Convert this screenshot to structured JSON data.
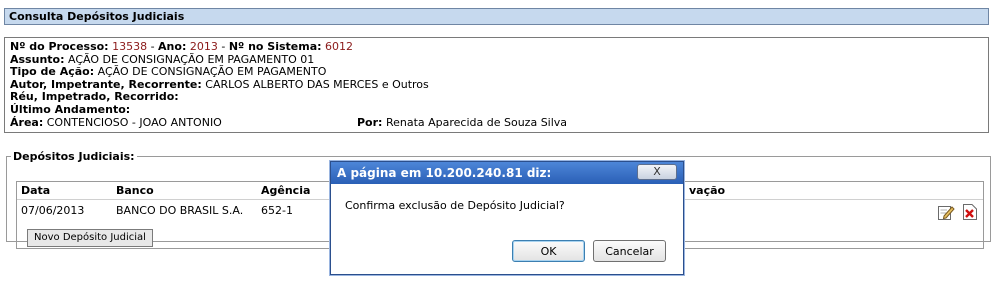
{
  "page": {
    "title": "Consulta Depósitos Judiciais"
  },
  "processo": {
    "numero_label": "Nº do Processo:",
    "numero": "13538",
    "ano_label": "Ano:",
    "ano": "2013",
    "sistema_label": "Nº no Sistema:",
    "sistema": "6012",
    "assunto_label": "Assunto:",
    "assunto": "AÇÃO DE CONSIGNAÇÃO EM PAGAMENTO 01",
    "tipo_label": "Tipo de Ação:",
    "tipo": "AÇÃO DE CONSIGNAÇÃO EM PAGAMENTO",
    "autor_label": "Autor, Impetrante, Recorrente:",
    "autor": "CARLOS ALBERTO DAS MERCES e Outros",
    "reu_label": "Réu, Impetrado, Recorrido:",
    "andamento_label": "Último Andamento:",
    "area_label": "Área:",
    "area": "CONTENCIOSO - JOAO ANTONIO",
    "por_label": "Por:",
    "por": "Renata Aparecida de Souza Silva"
  },
  "depositos": {
    "legend": "Depósitos Judiciais:",
    "columns": {
      "data": "Data",
      "banco": "Banco",
      "agencia": "Agência",
      "observacao_fragment": "vação"
    },
    "rows": [
      {
        "data": "07/06/2013",
        "banco": "BANCO DO BRASIL S.A.",
        "agencia": "652-1"
      }
    ],
    "novo_button": "Novo Depósito Judicial",
    "edit_icon": "edit-icon",
    "delete_icon": "delete-icon"
  },
  "dialog": {
    "title": "A página em 10.200.240.81 diz:",
    "close": "X",
    "message": "Confirma exclusão de Depósito Judicial?",
    "ok": "OK",
    "cancel": "Cancelar"
  }
}
